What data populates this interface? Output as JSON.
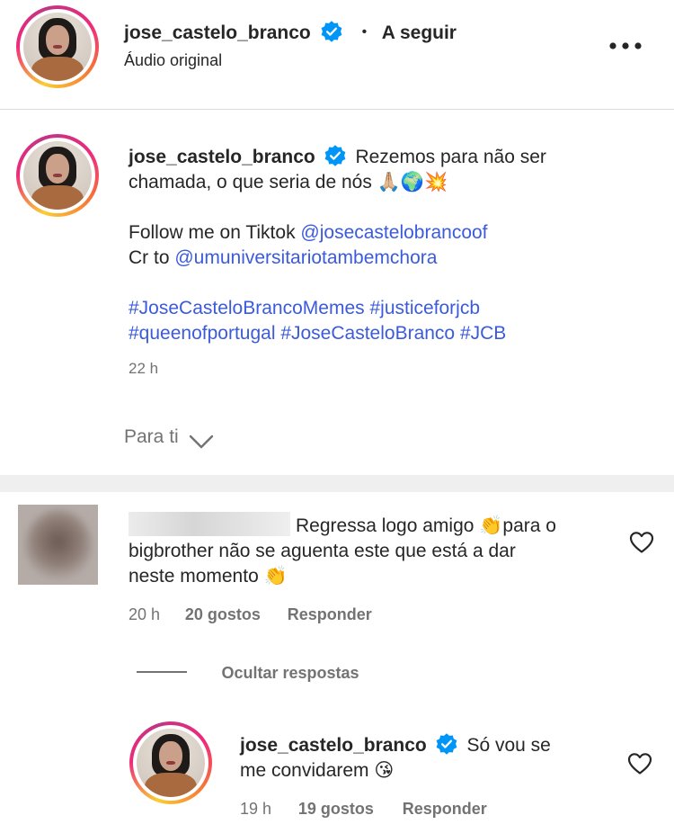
{
  "header": {
    "username": "jose_castelo_branco",
    "separator": "•",
    "follow_label": "A seguir",
    "subtitle": "Áudio original",
    "more_label": "•••"
  },
  "caption": {
    "username": "jose_castelo_branco",
    "text_line1": "Rezemos para não ser",
    "text_line2": "chamada, o que seria de nós 🙏🏼🌍💥",
    "follow_prefix": "Follow me on Tiktok ",
    "follow_handle": "@josecastelobrancoof",
    "credit_prefix": "Cr to ",
    "credit_handle": "@umuniversitariotambemchora",
    "hashtags_line1": [
      "#JoseCasteloBrancoMemes",
      "#justiceforjcb"
    ],
    "hashtags_line2": [
      "#queenofportugal",
      "#JoseCasteloBranco",
      "#JCB"
    ],
    "time": "22 h"
  },
  "filter": {
    "label": "Para ti"
  },
  "comment": {
    "text_line1": "Regressa logo amigo 👏para o",
    "text_line2": "bigbrother não se aguenta este que está a dar",
    "text_line3": "neste momento 👏",
    "time": "20 h",
    "likes": "20 gostos",
    "reply_label": "Responder",
    "hide_replies_label": "Ocultar respostas"
  },
  "reply": {
    "username": "jose_castelo_branco",
    "text_line1": "Só vou se",
    "text_line2": "me convidarem 😘",
    "time": "19 h",
    "likes": "19 gostos",
    "reply_label": "Responder"
  },
  "colors": {
    "link": "#3b5bdb",
    "verified": "#0095f6",
    "muted": "#737373"
  }
}
